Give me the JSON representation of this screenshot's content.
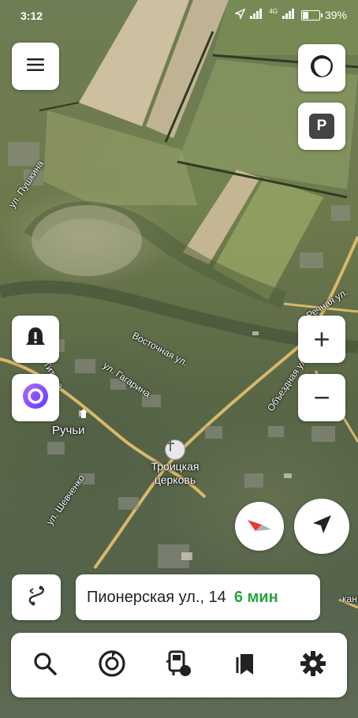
{
  "status_bar": {
    "time": "3:12",
    "network_badge": "4G",
    "battery_percent": "39%",
    "battery_level": 0.39
  },
  "map": {
    "streets": {
      "pushkina": "ул. Пушкина",
      "vostochnaya": "Восточная ул.",
      "gagarina": "ул. Гагарина",
      "titova": "Титова",
      "rechnaya": "Речная ул.",
      "obezdnaya": "Объездная ул.",
      "shevchenko": "ул. Шевченко",
      "edge_fragment": "кан"
    },
    "locality": "Ручьи",
    "poi": {
      "name_line1": "Троицкая",
      "name_line2": "церковь"
    }
  },
  "controls": {
    "menu_icon": "hamburger-menu-icon",
    "layers_icon": "map-layers-icon",
    "parking_label": "P",
    "zoom_in_label": "+",
    "zoom_out_label": "−",
    "alert_icon": "road-event-warning-icon",
    "assistant_icon": "alice-assistant-icon",
    "compass_icon": "compass-icon",
    "location_icon": "my-location-arrow-icon",
    "route_icon": "route-icon"
  },
  "route": {
    "address": "Пионерская ул., 14",
    "eta": "6 мин"
  },
  "bottom_tabs": [
    {
      "icon": "search-icon"
    },
    {
      "icon": "navigator-icon"
    },
    {
      "icon": "transport-icon"
    },
    {
      "icon": "bookmarks-icon"
    },
    {
      "icon": "settings-gear-icon"
    }
  ],
  "colors": {
    "accent_green": "#26a53e",
    "alice_purple": "#8a4dff",
    "compass_red": "#e53935",
    "road_yellow": "#d9b86a"
  }
}
